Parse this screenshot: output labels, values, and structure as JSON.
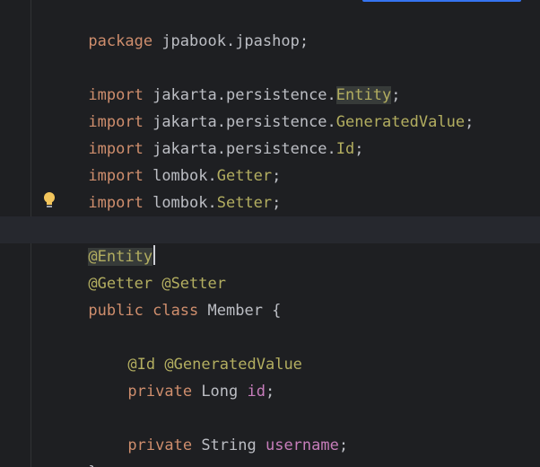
{
  "editor": {
    "lines": [
      {
        "id": "l1",
        "tokens": [
          "package",
          " jpabook.jpashop;"
        ]
      },
      {
        "id": "l3",
        "tokens": [
          "import",
          " jakarta.persistence.",
          "Entity",
          ";"
        ]
      },
      {
        "id": "l4",
        "tokens": [
          "import",
          " jakarta.persistence.",
          "GeneratedValue",
          ";"
        ]
      },
      {
        "id": "l5",
        "tokens": [
          "import",
          " jakarta.persistence.",
          "Id",
          ";"
        ]
      },
      {
        "id": "l6",
        "tokens": [
          "import",
          " lombok.",
          "Getter",
          ";"
        ]
      },
      {
        "id": "l7",
        "tokens": [
          "import",
          " lombok.",
          "Setter",
          ";"
        ]
      },
      {
        "id": "l9",
        "tokens": [
          "@Entity"
        ]
      },
      {
        "id": "l10",
        "tokens": [
          "@Getter",
          " ",
          "@Setter"
        ]
      },
      {
        "id": "l11",
        "tokens": [
          "public",
          " ",
          "class",
          " Member {"
        ]
      },
      {
        "id": "l13",
        "tokens": [
          "@Id",
          " ",
          "@GeneratedValue"
        ]
      },
      {
        "id": "l14",
        "tokens": [
          "private",
          " Long ",
          "id",
          ";"
        ]
      },
      {
        "id": "l16",
        "tokens": [
          "private",
          " String ",
          "username",
          ";"
        ]
      },
      {
        "id": "l17",
        "tokens": [
          "}"
        ]
      }
    ]
  },
  "icons": {
    "intention_bulb": "lightbulb-icon"
  },
  "colors": {
    "background": "#1e1f22",
    "keyword": "#cf8e6d",
    "annotation": "#b3ae60",
    "field": "#c77dbb",
    "text": "#bcbec4",
    "current_line": "#26282e"
  }
}
